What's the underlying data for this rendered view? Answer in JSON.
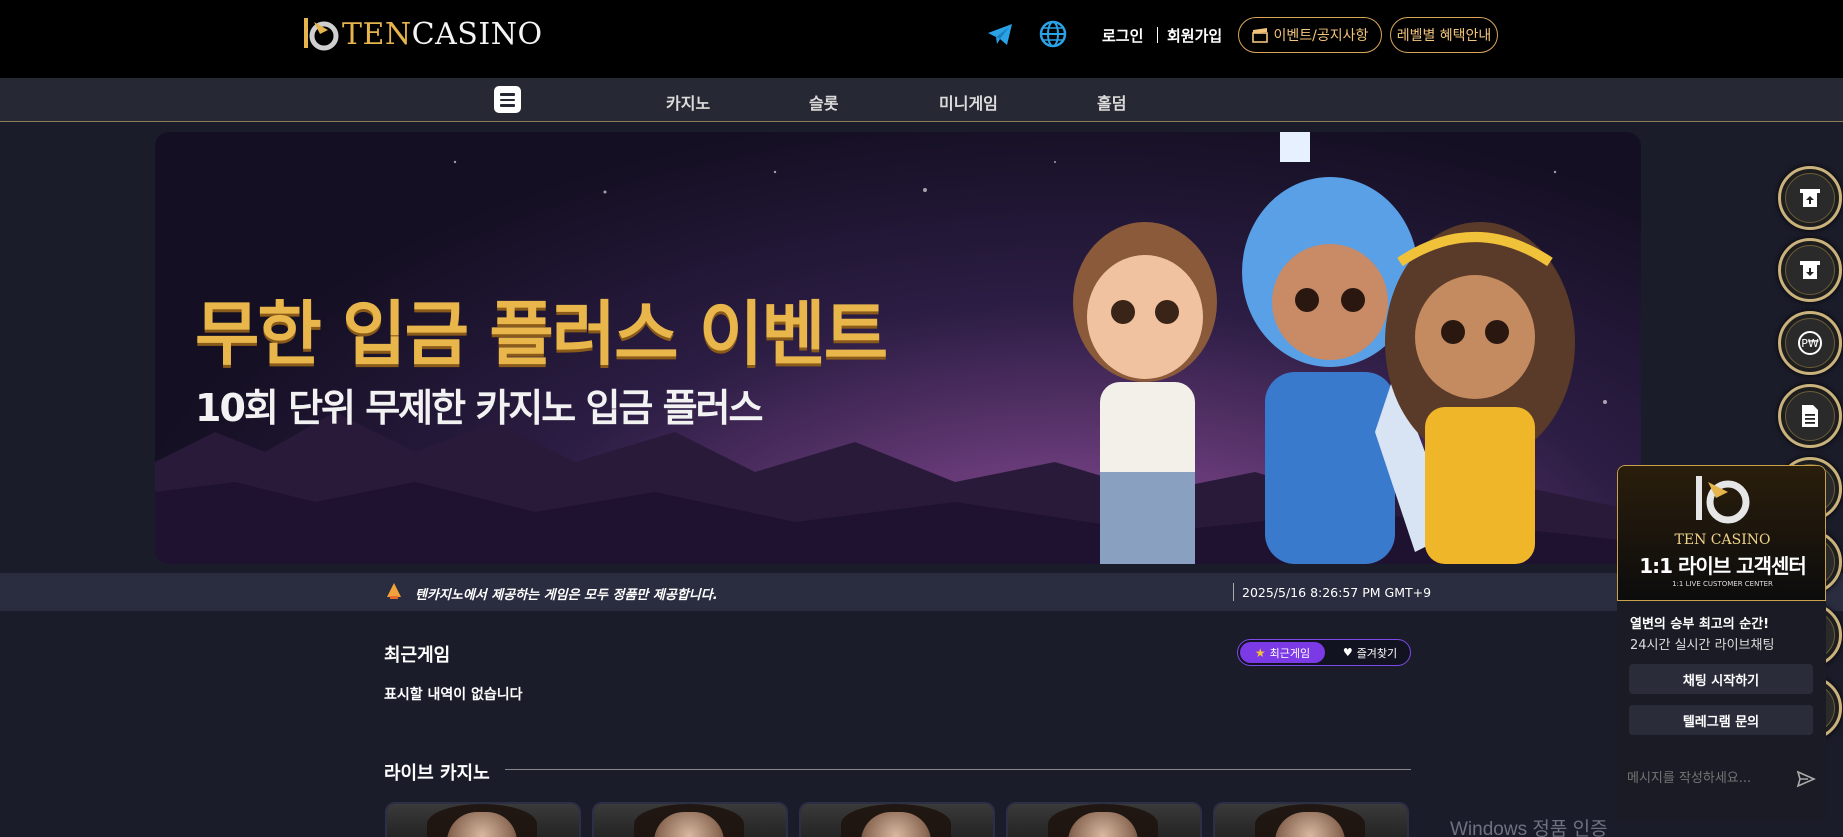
{
  "header": {
    "logo": {
      "ten": "TEN",
      "casino": "CASINO"
    },
    "icons": [
      "telegram-icon",
      "globe-icon"
    ],
    "login": "로그인",
    "signup": "회원가입",
    "events_button": "이벤트/공지사항",
    "level_button": "레벨별 혜택안내"
  },
  "nav": {
    "items": [
      "카지노",
      "슬롯",
      "미니게임",
      "홀덤"
    ]
  },
  "banner": {
    "title": "무한 입금 플러스 이벤트",
    "subtitle": "10회 단위 무제한 카지노 입금 플러스"
  },
  "notice": {
    "text": "텐카지노에서 제공하는 게임은 모두 정품만 제공합니다.",
    "time": "2025/5/16 8:26:57 PM GMT+9"
  },
  "recent": {
    "title": "최근게임",
    "tab_recent": "최근게임",
    "tab_favorites": "즐겨찾기",
    "empty": "표시할 내역이 없습니다"
  },
  "live_casino": {
    "title": "라이브 카지노"
  },
  "chat": {
    "brand": "TEN CASINO",
    "heading": "1:1 라이브 고객센터",
    "heading_en": "1:1 LIVE CUSTOMER CENTER",
    "message1": "열변의 승부 최고의 순간!",
    "message2": "24시간 실시간 라이브채팅",
    "start_button": "채팅 시작하기",
    "telegram_button": "텔레그램 문의",
    "input_placeholder": "메시지를 작성하세요..."
  },
  "watermark": "Windows 정품 인증",
  "colors": {
    "accent_gold": "#d8a65a",
    "accent_purple": "#7c39e6",
    "background": "#1b1c2a"
  }
}
